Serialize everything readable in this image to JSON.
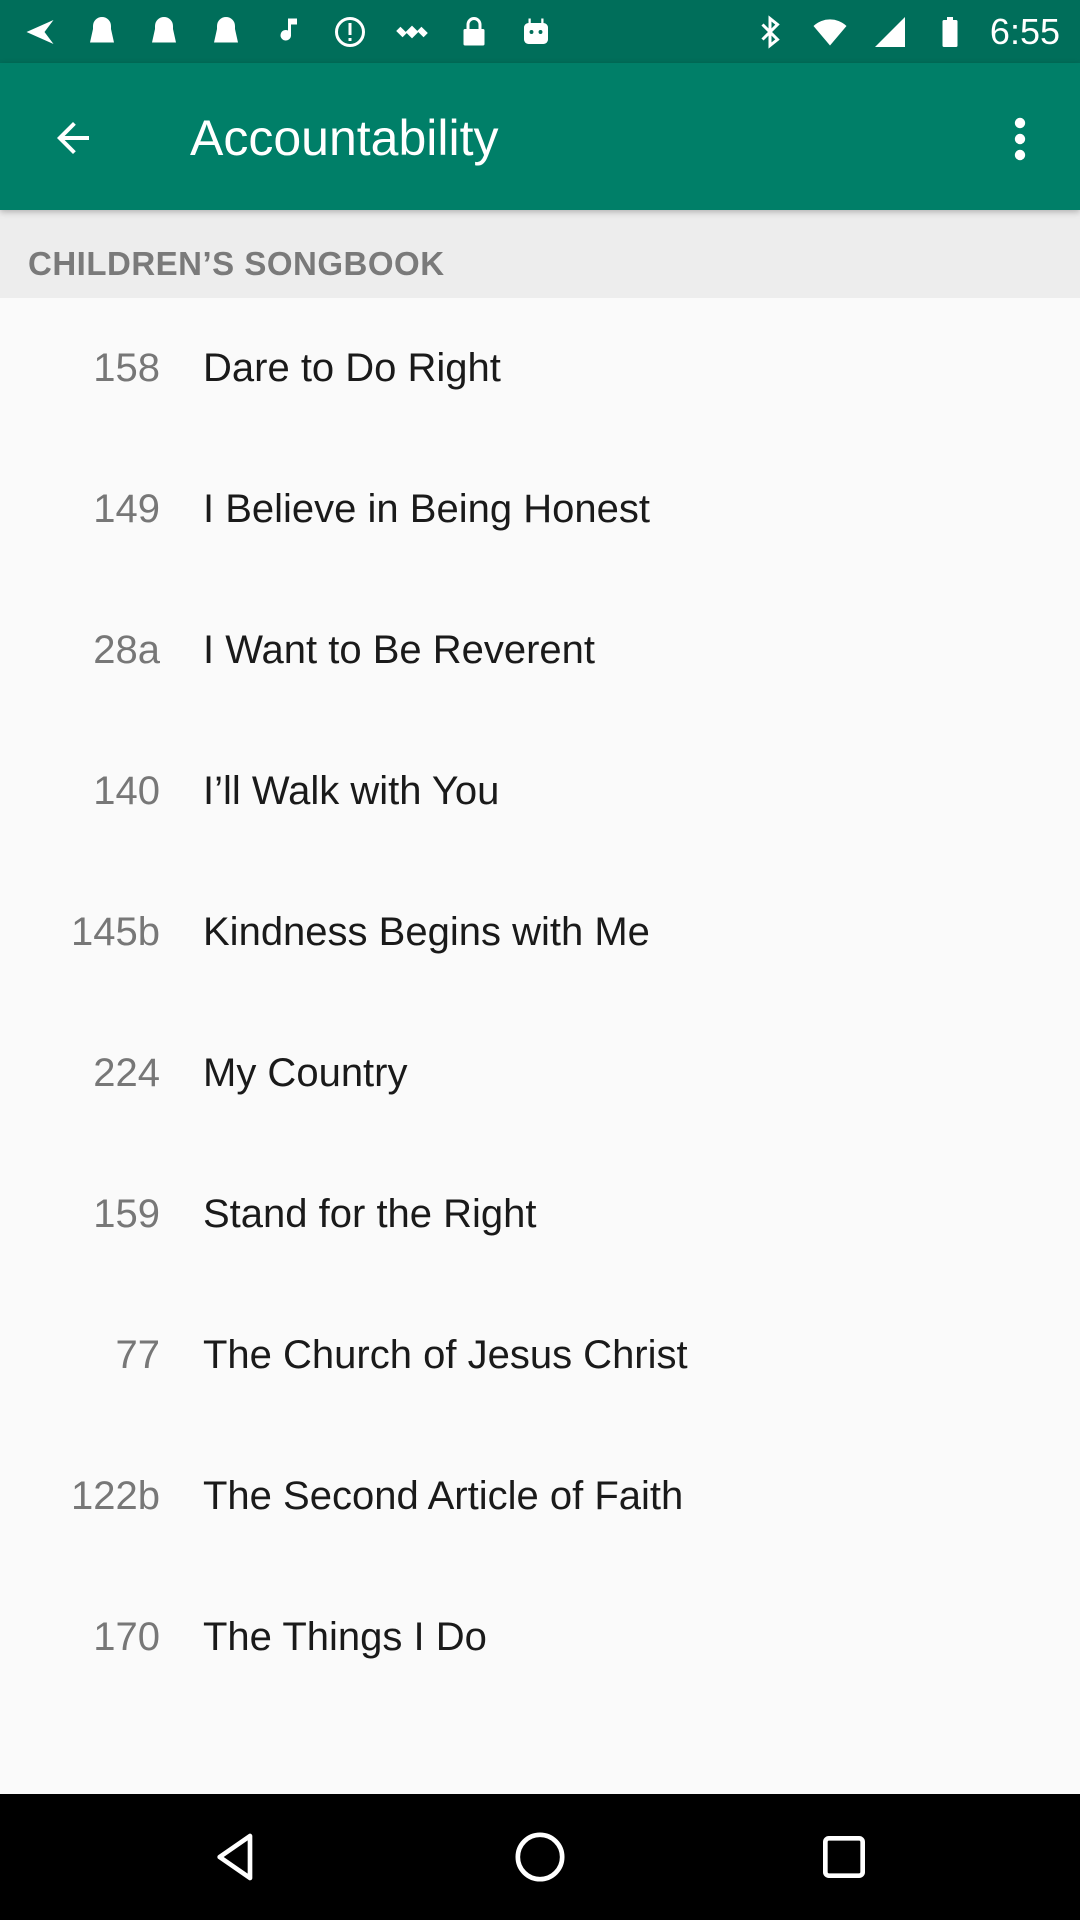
{
  "status_bar": {
    "time": "6:55",
    "left_icons": [
      "navigation-arrow-icon",
      "notification-icon",
      "notification-icon",
      "notification-icon",
      "music-note-icon",
      "alert-circle-icon",
      "satellite-icon",
      "lock-icon",
      "android-icon"
    ],
    "right_icons": [
      "bluetooth-icon",
      "wifi-icon",
      "cell-signal-icon",
      "battery-icon"
    ]
  },
  "app_bar": {
    "title": "Accountability",
    "back_icon": "arrow-back-icon",
    "menu_icon": "more-vert-icon",
    "background": "#007f68"
  },
  "section": {
    "title": "CHILDREN’S SONGBOOK"
  },
  "songs": [
    {
      "number": "158",
      "title": "Dare to Do Right"
    },
    {
      "number": "149",
      "title": "I Believe in Being Honest"
    },
    {
      "number": "28a",
      "title": "I Want to Be Reverent"
    },
    {
      "number": "140",
      "title": "I’ll Walk with You"
    },
    {
      "number": "145b",
      "title": "Kindness Begins with Me"
    },
    {
      "number": "224",
      "title": "My Country"
    },
    {
      "number": "159",
      "title": "Stand for the Right"
    },
    {
      "number": "77",
      "title": "The Church of Jesus Christ"
    },
    {
      "number": "122b",
      "title": "The Second Article of Faith"
    },
    {
      "number": "170",
      "title": "The Things I Do"
    }
  ],
  "nav_bar": {
    "buttons": [
      "back-triangle-icon",
      "home-circle-icon",
      "recents-square-icon"
    ]
  }
}
